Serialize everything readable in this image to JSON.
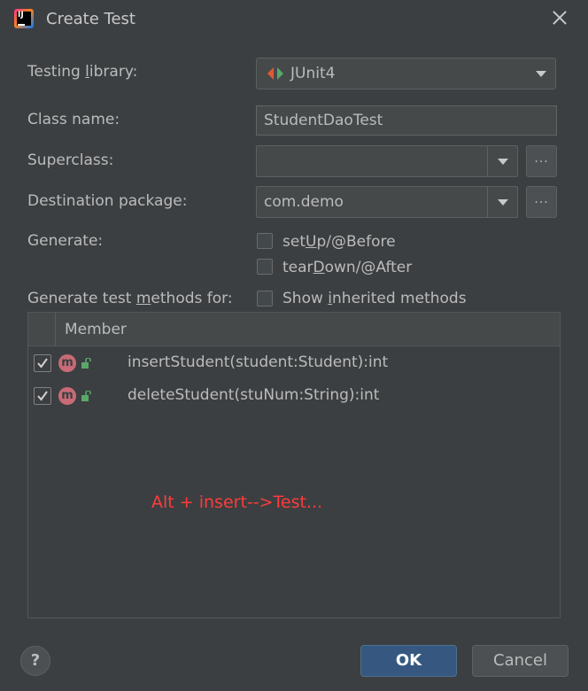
{
  "window": {
    "title": "Create Test"
  },
  "form": {
    "testing_library": {
      "label_pre": "Testing ",
      "label_mn": "l",
      "label_post": "ibrary:",
      "value": "JUnit4"
    },
    "class_name": {
      "label": "Class name:",
      "value": "StudentDaoTest"
    },
    "superclass": {
      "label": "Superclass:",
      "value": "",
      "browse_label": "..."
    },
    "destination_package": {
      "label": "Destination package:",
      "value": "com.demo",
      "browse_label": "..."
    },
    "generate": {
      "label": "Generate:",
      "setup": {
        "pre": "set",
        "mn": "U",
        "post": "p/@Before",
        "checked": false
      },
      "teardown": {
        "pre": "tear",
        "mn": "D",
        "post": "own/@After",
        "checked": false
      }
    },
    "methods_for": {
      "label_pre": "Generate test ",
      "label_mn": "m",
      "label_post": "ethods for:",
      "show_inherited": {
        "pre": "Show ",
        "mn": "i",
        "post": "nherited methods",
        "checked": false
      }
    }
  },
  "members_table": {
    "header": "Member",
    "rows": [
      {
        "icon": "m",
        "text": "insertStudent(student:Student):int",
        "checked": true
      },
      {
        "icon": "m",
        "text": "deleteStudent(stuNum:String):int",
        "checked": true
      }
    ]
  },
  "annotation": "Alt + insert-->Test...",
  "footer": {
    "help_label": "?",
    "ok_label": "OK",
    "cancel_label": "Cancel"
  },
  "colors": {
    "background": "#3c3f41",
    "field": "#45494a",
    "text": "#bbbbbb",
    "accent_button": "#365880",
    "annotation": "#ff3b3b",
    "method_icon": "#c86b76",
    "lock_icon": "#59a869"
  }
}
